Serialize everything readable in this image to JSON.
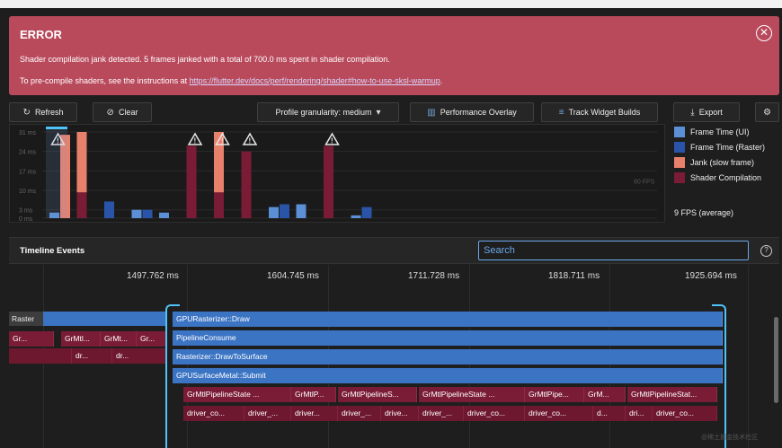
{
  "error": {
    "title": "ERROR",
    "message": "Shader compilation jank detected. 5 frames janked with a total of 700.0 ms spent in shader compilation.",
    "instructions_prefix": "To pre-compile shaders, see the instructions at ",
    "link": "https://flutter.dev/docs/perf/rendering/shader#how-to-use-sksl-warmup",
    "instructions_suffix": ".",
    "close_icon": "⊗"
  },
  "toolbar": {
    "refresh": "Refresh",
    "clear": "Clear",
    "granularity": "Profile granularity: medium",
    "performance_overlay": "Performance Overlay",
    "track_widget_builds": "Track Widget Builds",
    "export": "Export"
  },
  "chart_data": {
    "type": "bar",
    "y_ticks": [
      "31 ms",
      "24 ms",
      "17 ms",
      "10 ms",
      "3 ms",
      "0 ms"
    ],
    "fps_line_label": "60 FPS",
    "legend": [
      "Frame Time (UI)",
      "Frame Time (Raster)",
      "Jank (slow frame)",
      "Shader Compilation"
    ],
    "colors": {
      "ui": "#5b8fd6",
      "raster": "#2a54a8",
      "jank": "#e8816c",
      "shader": "#7a1c36",
      "warning": "#e8e8e8"
    },
    "frames": [
      {
        "ui": 2,
        "raster": 30,
        "jank": true,
        "shader": false,
        "warning": true
      },
      {
        "ui": 0,
        "raster": 31,
        "jank": true,
        "shader": true,
        "warning": false
      },
      {
        "ui": 0,
        "raster": 6,
        "jank": false,
        "shader": false,
        "warning": false
      },
      {
        "ui": 3,
        "raster": 3,
        "jank": false,
        "shader": false,
        "warning": false
      },
      {
        "ui": 2,
        "raster": 0,
        "jank": false,
        "shader": false,
        "warning": false
      },
      {
        "ui": 0,
        "raster": 26,
        "jank": false,
        "shader": true,
        "warning": true
      },
      {
        "ui": 0,
        "raster": 31,
        "jank": true,
        "shader": true,
        "warning": true
      },
      {
        "ui": 0,
        "raster": 24,
        "jank": false,
        "shader": true,
        "warning": true
      },
      {
        "ui": 4,
        "raster": 5,
        "jank": false,
        "shader": false,
        "warning": false
      },
      {
        "ui": 5,
        "raster": 0,
        "jank": false,
        "shader": false,
        "warning": false
      },
      {
        "ui": 0,
        "raster": 26,
        "jank": false,
        "shader": true,
        "warning": true
      },
      {
        "ui": 1,
        "raster": 4,
        "jank": false,
        "shader": false,
        "warning": false
      }
    ]
  },
  "fps_average": "9 FPS (average)",
  "timeline": {
    "title": "Timeline Events",
    "search_placeholder": "Search",
    "help_icon": "?",
    "time_labels": [
      "1497.762 ms",
      "1604.745 ms",
      "1711.728 ms",
      "1818.711 ms",
      "1925.694 ms"
    ],
    "raster_label": "Raster",
    "events": {
      "gpu_draw": "GPURasterizer::Draw",
      "pipeline": "PipelineConsume",
      "draw_to_surface": "Rasterizer::DrawToSurface",
      "submit": "GPUSurfaceMetal::Submit",
      "left_row1": [
        "Gr...",
        "GrMtl...",
        "GrMt...",
        "Gr..."
      ],
      "left_row2": [
        "dr...",
        "dr..."
      ],
      "pipeline_states": [
        "GrMtlPipelineState ...",
        "GrMtlP...",
        "GrMtlPipelineS...",
        "GrMtlPipelineState ...",
        "GrMtlPipe...",
        "GrM...",
        "GrMtlPipelineStat..."
      ],
      "drivers": [
        "driver_co...",
        "driver_...",
        "driver...",
        "driver_...",
        "drive...",
        "driver_...",
        "driver_co...",
        "driver_co...",
        "d...",
        "dri...",
        "driver_co..."
      ]
    }
  },
  "watermark": "@稀土掘金技术社区"
}
